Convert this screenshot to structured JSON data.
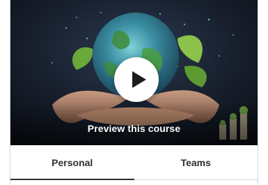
{
  "preview": {
    "label": "Preview this course",
    "image_icon": "globe-in-hands-image",
    "play_icon": "play-icon"
  },
  "tabs": [
    {
      "label": "Personal",
      "active": true
    },
    {
      "label": "Teams",
      "active": false
    }
  ],
  "colors": {
    "tab_text": "#2d2f31",
    "active_underline": "#2d2f31",
    "border": "#d1d7dc",
    "preview_bg": "#141b2a"
  }
}
